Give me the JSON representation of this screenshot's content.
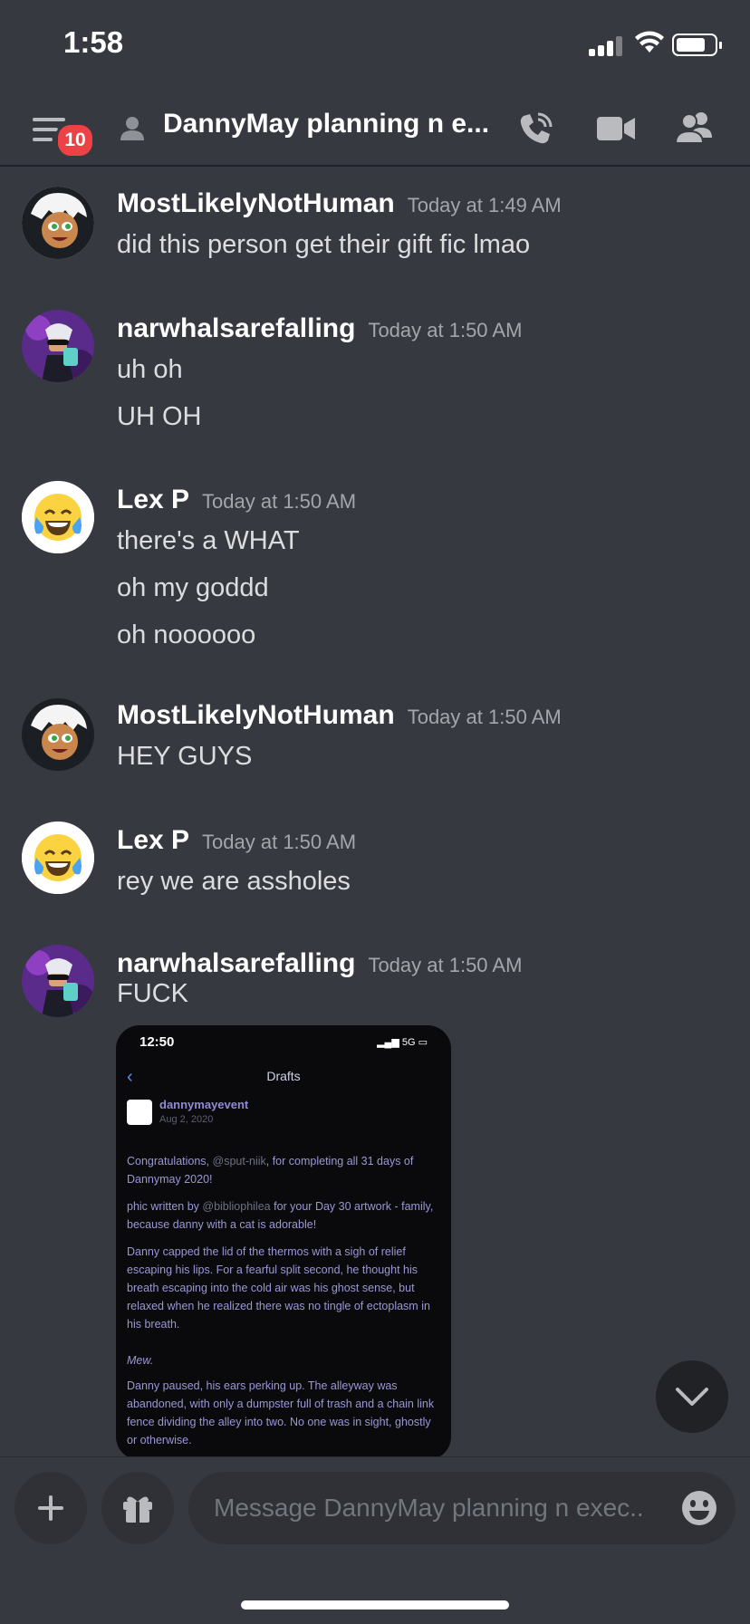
{
  "status_bar": {
    "time": "1:58"
  },
  "header": {
    "notification_count": "10",
    "channel_title": "DannyMay planning n e..."
  },
  "messages": [
    {
      "username": "MostLikelyNotHuman",
      "timestamp": "Today at 1:49 AM",
      "lines": [
        "did this person get their gift fic lmao"
      ]
    },
    {
      "username": "narwhalsarefalling",
      "timestamp": "Today at 1:50 AM",
      "lines": [
        "uh oh",
        "UH OH"
      ]
    },
    {
      "username": "Lex P",
      "timestamp": "Today at 1:50 AM",
      "lines": [
        "there's a WHAT",
        "oh my goddd",
        "oh noooooo"
      ]
    },
    {
      "username": "MostLikelyNotHuman",
      "timestamp": "Today at 1:50 AM",
      "lines": [
        "HEY GUYS"
      ]
    },
    {
      "username": "Lex P",
      "timestamp": "Today at 1:50 AM",
      "lines": [
        "rey we are assholes"
      ]
    },
    {
      "username": "narwhalsarefalling",
      "timestamp": "Today at 1:50 AM",
      "lines": [
        "FUCK"
      ]
    }
  ],
  "attachment": {
    "phone_time": "12:50",
    "phone_network": "5G",
    "screen_title": "Drafts",
    "blog_name": "dannymayevent",
    "blog_date": "Aug 2, 2020",
    "p1_a": "Congratulations, ",
    "p1_link": "@sput-niik",
    "p1_b": ", for completing all 31 days of Dannymay 2020!",
    "p2_a": "phic written by ",
    "p2_link": "@bibliophilea",
    "p2_b": " for your Day 30 artwork - family, because danny with a cat is adorable!",
    "p3": "Danny capped the lid of the thermos with a sigh of relief escaping his lips. For a fearful split second, he thought his breath escaping into the cold air was his ghost sense, but relaxed when he realized there was no tingle of ectoplasm in his breath.",
    "p4": "Mew.",
    "p5": "Danny paused, his ears perking up. The alleyway was abandoned, with only a dumpster full of trash and a chain link fence dividing the alley into two. No one was in sight, ghostly or otherwise."
  },
  "composer": {
    "placeholder": "Message DannyMay planning n exec.."
  },
  "colors": {
    "background": "#36393f",
    "badge": "#ed4245",
    "username": "#ffffff",
    "timestamp": "#a3a6aa",
    "text": "#dcddde"
  }
}
